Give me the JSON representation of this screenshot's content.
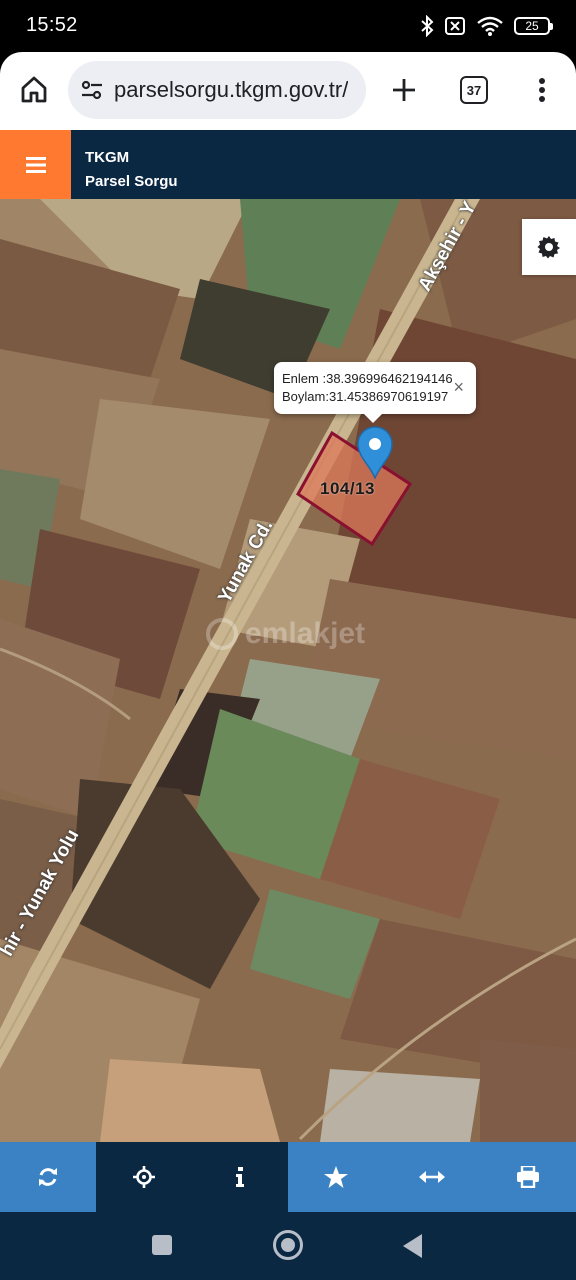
{
  "status_bar": {
    "time": "15:52",
    "battery": "25",
    "icons": [
      "bluetooth-icon",
      "no-sim-icon",
      "wifi-icon",
      "battery-icon"
    ]
  },
  "browser": {
    "url": "parselsorgu.tkgm.gov.tr/",
    "tab_count": "37",
    "icons": [
      "home-icon",
      "site-settings-icon",
      "plus-icon",
      "more-vert-icon"
    ]
  },
  "header": {
    "title": "TKGM",
    "subtitle": "Parsel Sorgu",
    "menu_icon": "hamburger-icon",
    "accent_color": "#ff7a30",
    "bg_color": "#0b2843"
  },
  "map": {
    "popup": {
      "lat_label": "Enlem",
      "lat_value": ":38.396996462194146",
      "lon_label": "Boylam",
      "lon_value": ":31.45386970619197",
      "close": "×"
    },
    "parcel_label": "104/13",
    "roads": [
      "Akşehir - Y",
      "Yunak Cd.",
      "hir - Yunak Yolu"
    ],
    "watermark": "emlakjet",
    "settings_icon": "gear-icon"
  },
  "toolbar": {
    "items": [
      {
        "icon": "refresh-icon"
      },
      {
        "icon": "locate-icon"
      },
      {
        "icon": "info-icon"
      },
      {
        "icon": "star-icon"
      },
      {
        "icon": "measure-icon"
      },
      {
        "icon": "print-icon"
      }
    ],
    "colors": {
      "light": "#3a82c4",
      "dark": "#0b2843"
    }
  },
  "nav_bar": {
    "icons": [
      "recents-icon",
      "home-icon",
      "back-icon"
    ]
  }
}
